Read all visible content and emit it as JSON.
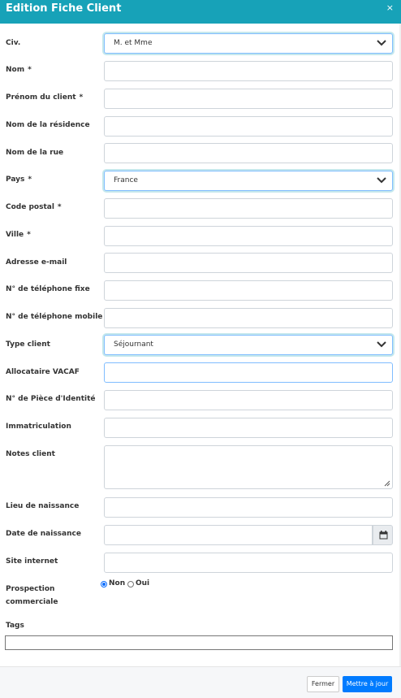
{
  "header": {
    "title": "Edition Fiche Client",
    "close": "×"
  },
  "labels": {
    "civ": "Civ.",
    "nom": "Nom",
    "prenom": "Prénom du client",
    "residence": "Nom de la résidence",
    "rue": "Nom de la rue",
    "pays": "Pays",
    "cp": "Code postal",
    "ville": "Ville",
    "email": "Adresse e-mail",
    "tel_fixe": "N° de téléphone fixe",
    "tel_mobile": "N° de téléphone mobile",
    "type_client": "Type client",
    "vacaf": "Allocataire VACAF",
    "piece": "N° de Pièce d'Identité",
    "immat": "Immatriculation",
    "notes": "Notes client",
    "lieu_naissance": "Lieu de naissance",
    "date_naissance": "Date de naissance",
    "site": "Site internet",
    "prospection_1": "Prospection",
    "prospection_2": "commerciale",
    "tags": "Tags",
    "required_mark": "*"
  },
  "values": {
    "civ": "M. et Mme",
    "pays": "France",
    "type_client": "Séjournant"
  },
  "radio": {
    "non": "Non",
    "oui": "Oui",
    "selected": "Non"
  },
  "footer": {
    "close_label": "Fermer",
    "save_label": "Mettre à jour"
  },
  "colors": {
    "header": "#17a2b8",
    "primary_button": "#007bff",
    "focus_border": "#80bdff"
  }
}
